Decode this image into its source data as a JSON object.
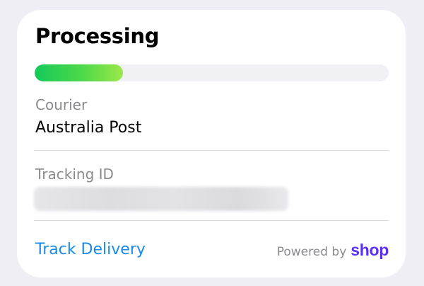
{
  "status": {
    "title": "Processing",
    "progress_fraction": 0.25
  },
  "courier": {
    "label": "Courier",
    "value": "Australia Post"
  },
  "tracking": {
    "label": "Tracking ID",
    "value_redacted": true
  },
  "footer": {
    "track_link": "Track Delivery",
    "powered_by": "Powered by",
    "brand": "shop"
  },
  "colors": {
    "background": "#efeef4",
    "card": "#ffffff",
    "progress_start": "#14c95a",
    "progress_end": "#9be84a",
    "progress_track": "#f0f0f5",
    "link": "#1a8ae8",
    "brand": "#5a31f4",
    "secondary_text": "#8a8a8e"
  }
}
